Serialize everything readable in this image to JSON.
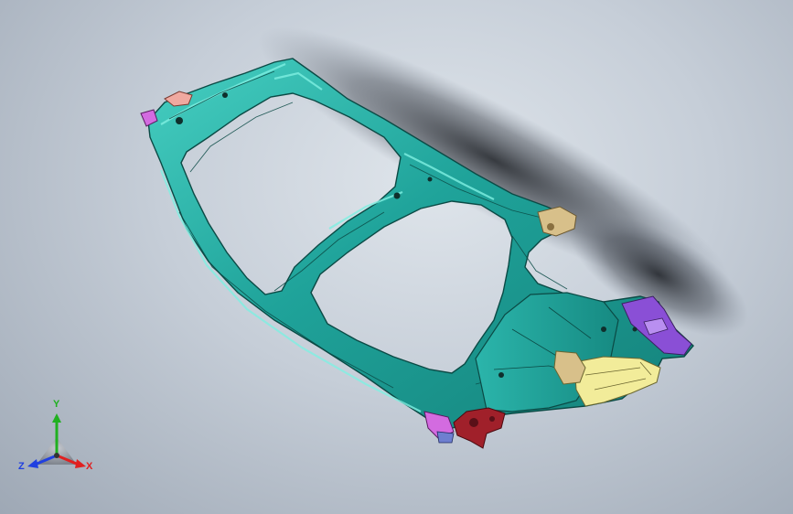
{
  "viewport": {
    "background_top": "#dfe5eb",
    "background_bottom": "#9ea8b5"
  },
  "model": {
    "part_colors": {
      "frame": "#1fa39a",
      "frame_highlight": "#5fe0d2",
      "frame_edge": "#0b4a45",
      "bracket_red": "#a0202a",
      "bracket_yellow": "#f2ec9a",
      "bracket_purple": "#8a4fd6",
      "bracket_magenta": "#d36be0",
      "bracket_tan": "#d8c08a",
      "pad_pink": "#f0a9a0"
    }
  },
  "triad": {
    "x_label": "X",
    "y_label": "Y",
    "z_label": "Z",
    "x_color": "#e02020",
    "y_color": "#20b020",
    "z_color": "#2040e0",
    "icon": "coordinate-triad-icon"
  }
}
